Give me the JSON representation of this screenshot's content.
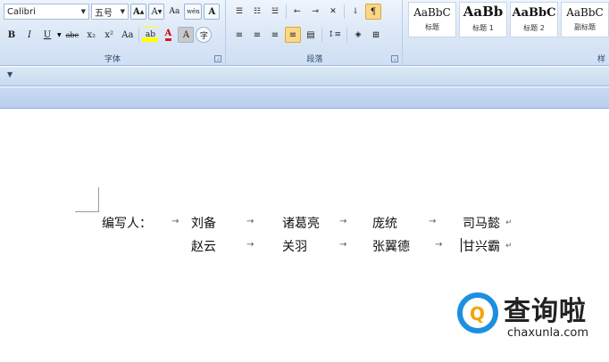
{
  "ribbon": {
    "font_group": {
      "label": "字体",
      "font_name": "Calibri",
      "font_size": "五号",
      "grow_label": "A",
      "shrink_label": "A",
      "change_case_label": "Aa",
      "clear_format_label": "A",
      "phonetic_label": "wén",
      "char_border_label": "A",
      "bold_label": "B",
      "italic_label": "I",
      "underline_label": "U",
      "strike_label": "abe",
      "sub_label": "x₂",
      "sup_label": "x²",
      "case_label": "Aa",
      "highlight_label": "ab",
      "color_label": "A",
      "shading_label": "A",
      "encircle_label": "字"
    },
    "paragraph_group": {
      "label": "段落"
    },
    "styles_group": {
      "label": "样",
      "items": [
        {
          "preview": "AaBbC",
          "name": "标题"
        },
        {
          "preview": "AaBb",
          "name": "标题 1"
        },
        {
          "preview": "AaBbC",
          "name": "标题 2"
        },
        {
          "preview": "AaBbC",
          "name": "副标题"
        }
      ]
    },
    "launcher_glyph": "⌟"
  },
  "qat": {
    "caret": "▼"
  },
  "document": {
    "line1": {
      "label": "编写人：",
      "names": [
        "刘备",
        "诸葛亮",
        "庞统",
        "司马懿"
      ]
    },
    "line2": {
      "names": [
        "赵云",
        "关羽",
        "张翼德",
        "甘兴霸"
      ]
    },
    "tab_mark": "→",
    "para_mark": "↵"
  },
  "watermark": {
    "cn": "查询啦",
    "en": "chaxunla.com",
    "logo_glyph": "Q"
  },
  "colors": {
    "accent": "#1e8fe0",
    "logo_orange": "#f5a300",
    "highlight": "#fbd785"
  }
}
